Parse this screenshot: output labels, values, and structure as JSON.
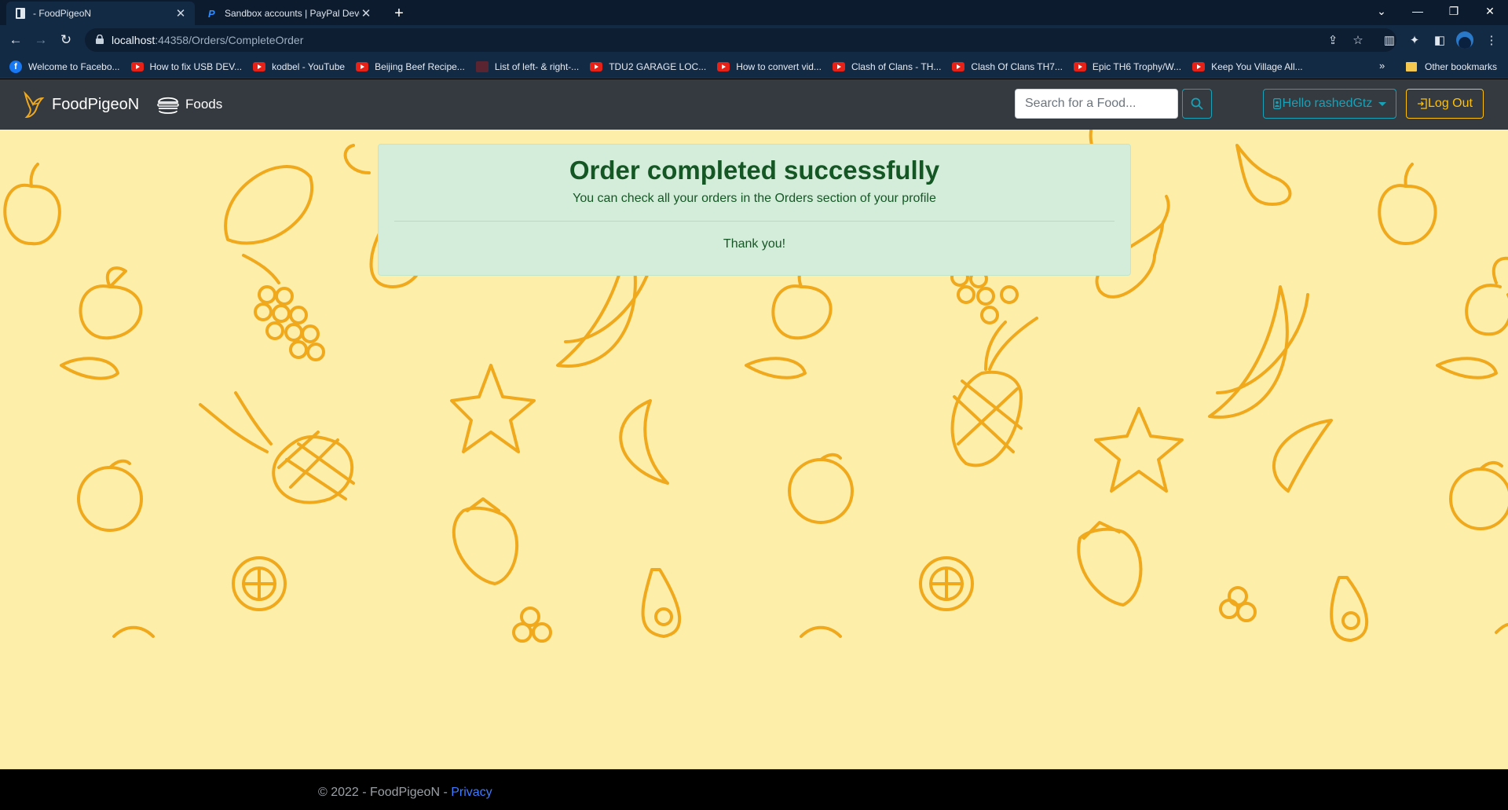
{
  "browser": {
    "tabs": [
      {
        "title": " - FoodPigeoN",
        "active": true
      },
      {
        "title": "Sandbox accounts | PayPal Devel",
        "active": false
      }
    ],
    "url_host": "localhost",
    "url_path": ":44358/Orders/CompleteOrder",
    "bookmarks": [
      {
        "label": "Welcome to Facebo...",
        "icon": "facebook-icon"
      },
      {
        "label": "How to fix USB DEV...",
        "icon": "youtube-icon"
      },
      {
        "label": "kodbel - YouTube",
        "icon": "youtube-icon"
      },
      {
        "label": "Beijing Beef Recipe...",
        "icon": "youtube-icon"
      },
      {
        "label": "List of left- & right-...",
        "icon": "game-icon"
      },
      {
        "label": "TDU2 GARAGE LOC...",
        "icon": "youtube-icon"
      },
      {
        "label": "How to convert vid...",
        "icon": "youtube-icon"
      },
      {
        "label": "Clash of Clans - TH...",
        "icon": "youtube-icon"
      },
      {
        "label": "Clash Of Clans TH7...",
        "icon": "youtube-icon"
      },
      {
        "label": "Epic TH6 Trophy/W...",
        "icon": "youtube-icon"
      },
      {
        "label": "Keep You Village All...",
        "icon": "youtube-icon"
      }
    ],
    "bookmarks_more": "»",
    "other_bookmarks": "Other bookmarks"
  },
  "navbar": {
    "brand": "FoodPigeoN",
    "foods_label": "Foods",
    "search_placeholder": "Search for a Food...",
    "user_label": "Hello rashedGtz",
    "logout_label": "Log Out"
  },
  "alert": {
    "title": "Order completed successfully",
    "subtitle": "You can check all your orders in the Orders section of your profile",
    "thanks": "Thank you!"
  },
  "footer": {
    "text": "© 2022 - FoodPigeoN - ",
    "privacy": "Privacy"
  },
  "colors": {
    "navbar_bg": "#343a40",
    "page_bg": "#fdeeaa",
    "fruit_stroke": "#f0a81c",
    "alert_bg": "#d4edda",
    "alert_text": "#155724",
    "info": "#17a2b8",
    "warning": "#ffc107"
  }
}
